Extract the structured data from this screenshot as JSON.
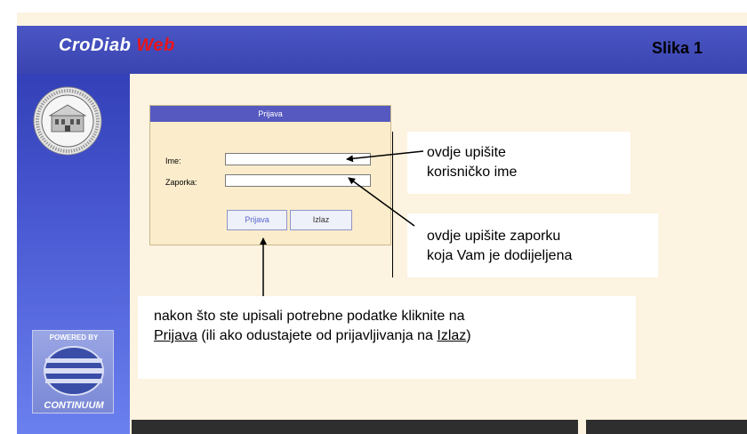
{
  "header": {
    "brand_main": "CroDiab",
    "brand_accent": "Web",
    "slide_label": "Slika 1"
  },
  "login": {
    "title": "Prijava",
    "username_label": "Ime:",
    "password_label": "Zaporka:",
    "username_value": "",
    "password_value": "",
    "login_button": "Prijava",
    "exit_button": "Izlaz"
  },
  "callouts": {
    "username_hint_line1": "ovdje upišite",
    "username_hint_line2": "korisničko ime",
    "password_hint_line1": "ovdje upišite zaporku",
    "password_hint_line2": "koja Vam je dodijeljena",
    "bottom_hint_line1": "nakon što ste upisali potrebne podatke kliknite na",
    "bottom_hint_link1": "Prijava",
    "bottom_hint_mid": " (ili ako odustajete od prijavljivanja na ",
    "bottom_hint_link2": "Izlaz",
    "bottom_hint_end": ")"
  },
  "sidebar": {
    "powered_by": "POWERED BY",
    "partner": "CONTINUUM"
  },
  "colors": {
    "header_bg": "#3a44b0",
    "brand_accent": "#e8141b",
    "login_title_bg": "#5659c0",
    "page_bg": "#fcf3e0"
  }
}
